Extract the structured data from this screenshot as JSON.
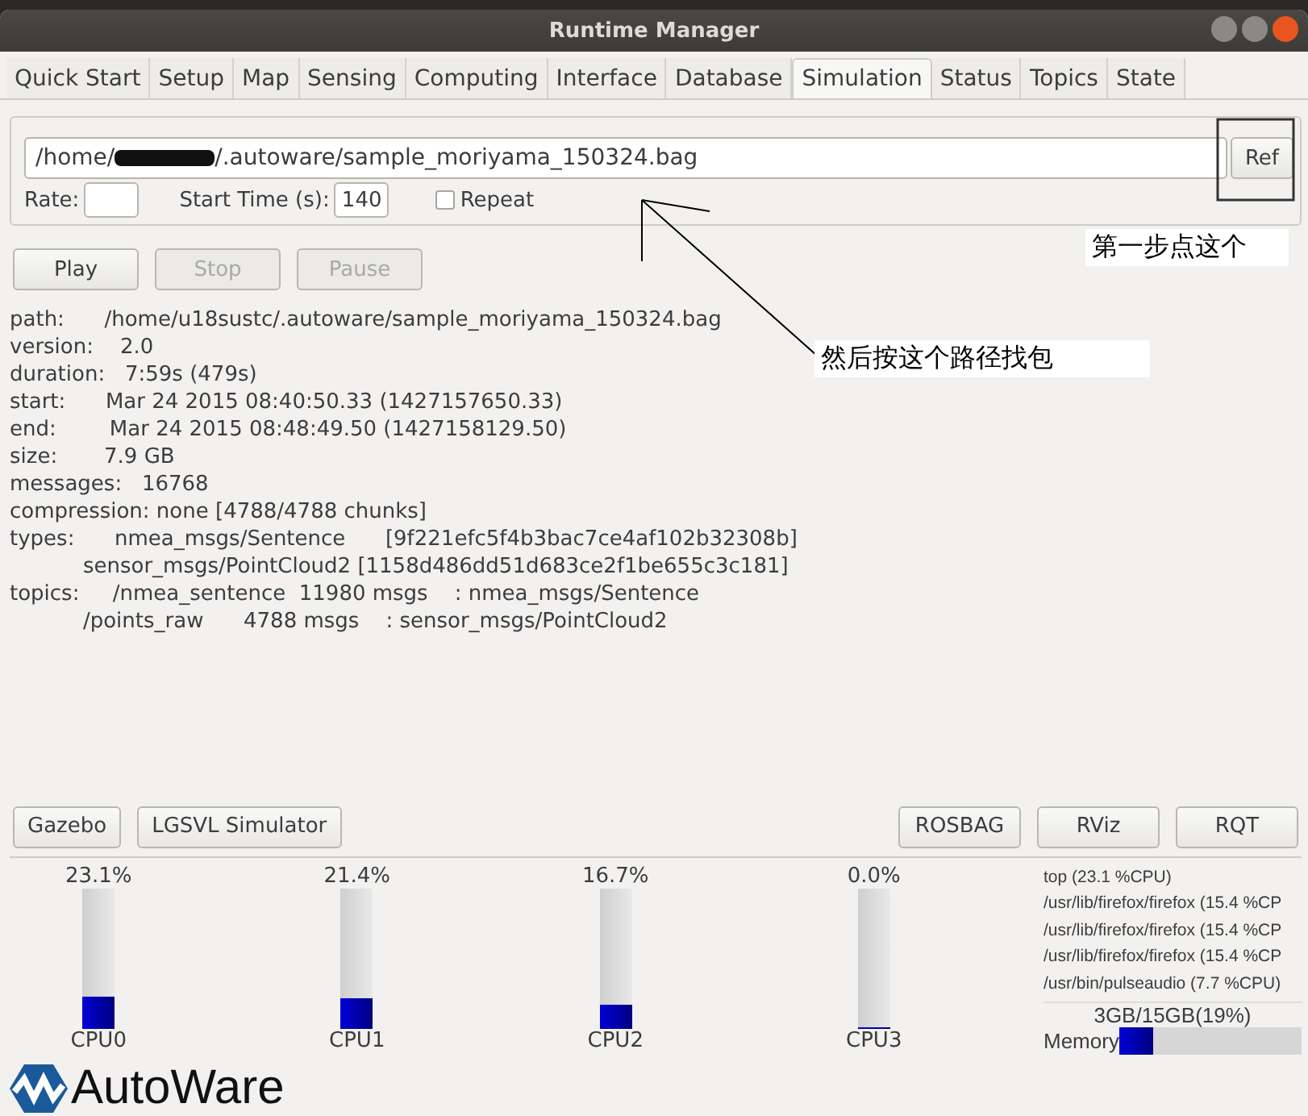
{
  "window": {
    "title": "Runtime Manager"
  },
  "tabs": [
    {
      "label": "Quick Start",
      "selected": false
    },
    {
      "label": "Setup",
      "selected": false
    },
    {
      "label": "Map",
      "selected": false
    },
    {
      "label": "Sensing",
      "selected": false
    },
    {
      "label": "Computing",
      "selected": false
    },
    {
      "label": "Interface",
      "selected": false
    },
    {
      "label": "Database",
      "selected": false
    },
    {
      "label": "Simulation",
      "selected": true
    },
    {
      "label": "Status",
      "selected": false
    },
    {
      "label": "Topics",
      "selected": false
    },
    {
      "label": "State",
      "selected": false
    }
  ],
  "bag_file": {
    "value_prefix": "/home/",
    "value_suffix": "/.autoware/sample_moriyama_150324.bag",
    "redacted": true,
    "ref_button": "Ref"
  },
  "rate": {
    "label": "Rate:"
  },
  "start_time": {
    "label": "Start Time (s):",
    "value": "140"
  },
  "repeat": {
    "label": "Repeat",
    "checked": false
  },
  "playback_buttons": [
    {
      "label": "Play",
      "disabled": false
    },
    {
      "label": "Stop",
      "disabled": true
    },
    {
      "label": "Pause",
      "disabled": true
    }
  ],
  "bag_info": [
    "path:      /home/u18sustc/.autoware/sample_moriyama_150324.bag",
    "version:    2.0",
    "duration:   7:59s (479s)",
    "start:      Mar 24 2015 08:40:50.33 (1427157650.33)",
    "end:        Mar 24 2015 08:48:49.50 (1427158129.50)",
    "size:       7.9 GB",
    "messages:   16768",
    "compression: none [4788/4788 chunks]",
    "types:      nmea_msgs/Sentence      [9f221efc5f4b3bac7ce4af102b32308b]",
    "           sensor_msgs/PointCloud2 [1158d486dd51d683ce2f1be655c3c181]",
    "topics:     /nmea_sentence  11980 msgs    : nmea_msgs/Sentence",
    "           /points_raw      4788 msgs    : sensor_msgs/PointCloud2"
  ],
  "tool_buttons_left": [
    "Gazebo",
    "LGSVL Simulator"
  ],
  "tool_buttons_right": [
    "ROSBAG",
    "RViz",
    "RQT"
  ],
  "cpus": [
    {
      "reading": "23.1%",
      "level": 0.231,
      "name": "CPU0"
    },
    {
      "reading": "21.4%",
      "level": 0.214,
      "name": "CPU1"
    },
    {
      "reading": "16.7%",
      "level": 0.167,
      "name": "CPU2"
    },
    {
      "reading": "0.0%",
      "level": 0,
      "name": "CPU3"
    }
  ],
  "processes": [
    "top (23.1 %CPU)",
    "/usr/lib/firefox/firefox (15.4 %CP",
    "/usr/lib/firefox/firefox (15.4 %CP",
    "/usr/lib/firefox/firefox (15.4 %CP",
    "/usr/bin/pulseaudio (7.7 %CPU)"
  ],
  "memory": {
    "reading": "3GB/15GB(19%)",
    "label": "Memory",
    "level": 0.19
  },
  "logo": {
    "text": "AutoWare"
  },
  "annotations": [
    {
      "text": "第一步点这个"
    },
    {
      "text": "然后按这个路径找包"
    }
  ]
}
